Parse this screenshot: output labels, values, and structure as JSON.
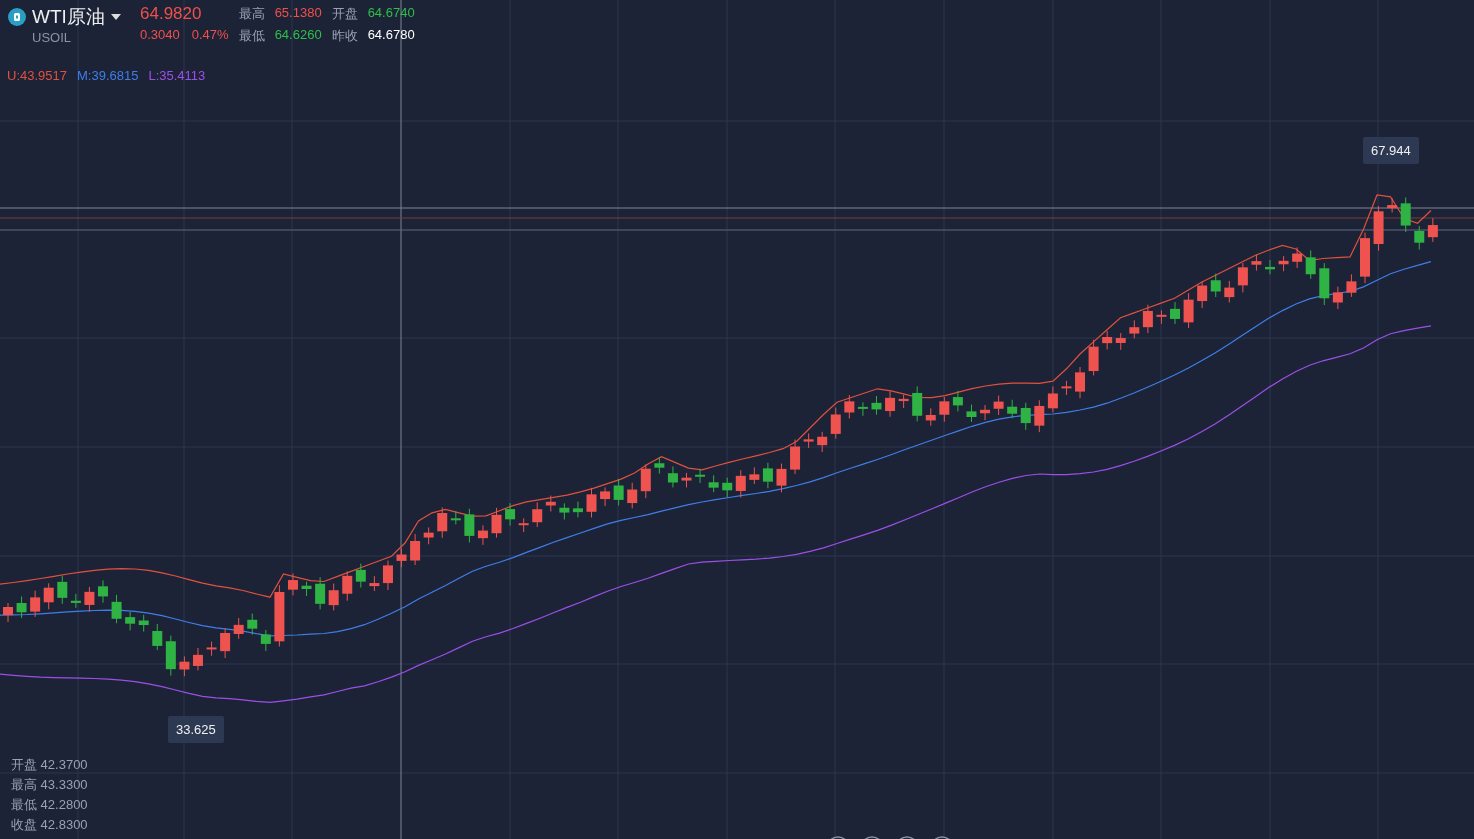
{
  "symbol": {
    "name": "WTI原油",
    "code": "USOIL",
    "price": "64.9820",
    "change": "0.3040",
    "change_pct": "0.47%"
  },
  "stats": [
    {
      "label": "最高",
      "value": "65.1380",
      "color": "#f0504b"
    },
    {
      "label": "开盘",
      "value": "64.6740",
      "color": "#2fbf4a"
    },
    {
      "label": "最低",
      "value": "64.6260",
      "color": "#2fbf4a"
    },
    {
      "label": "昨收",
      "value": "64.6780",
      "color": "#ffffff"
    }
  ],
  "bands": [
    {
      "label": "U:43.9517",
      "color": "#e0513f"
    },
    {
      "label": "M:39.6815",
      "color": "#3f7ee8"
    },
    {
      "label": "L:35.4113",
      "color": "#9c4fe8"
    }
  ],
  "markers": [
    {
      "kind": "high",
      "text": "67.944"
    },
    {
      "kind": "low",
      "text": "33.625"
    }
  ],
  "ohlc": [
    {
      "label": "开盘",
      "value": "42.3700"
    },
    {
      "label": "最高",
      "value": "43.3300"
    },
    {
      "label": "最低",
      "value": "42.2800"
    },
    {
      "label": "收盘",
      "value": "42.8300"
    }
  ]
}
